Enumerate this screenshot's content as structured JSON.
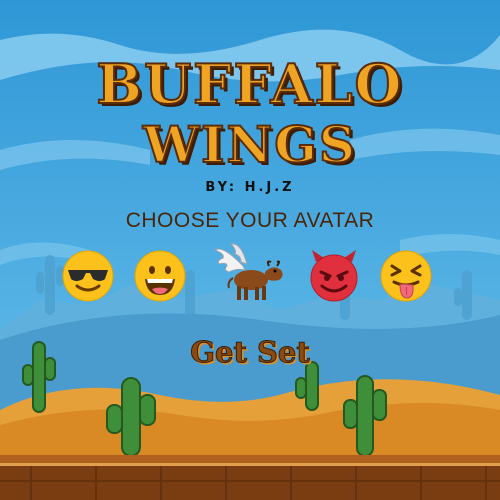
{
  "title": {
    "line1": "BUFFALO",
    "line2": "WINGS"
  },
  "byline": "BY:  H.J.Z",
  "avatar_prompt": "CHOOSE YOUR  AVATAR",
  "avatars": [
    {
      "name": "sunglasses-emoji"
    },
    {
      "name": "laughing-emoji"
    },
    {
      "name": "winged-buffalo"
    },
    {
      "name": "devil-emoji"
    },
    {
      "name": "tongue-out-wink-emoji"
    }
  ],
  "start_button": "Get Set",
  "colors": {
    "sky": "#3aa3dc",
    "sand": "#e39a2c",
    "cactus": "#3f8f3a",
    "title": "#f0a423",
    "title_outline": "#5a2c0a",
    "ground": "#7a3d12"
  }
}
